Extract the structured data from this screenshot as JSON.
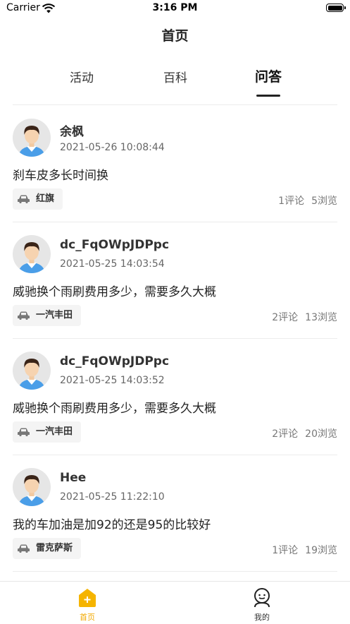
{
  "status_bar": {
    "carrier": "Carrier",
    "time": "3:16 PM"
  },
  "nav": {
    "title": "首页"
  },
  "tabs": [
    {
      "label": "活动"
    },
    {
      "label": "百科"
    },
    {
      "label": "问答",
      "active": true
    }
  ],
  "posts": [
    {
      "username": "余枫",
      "time": "2021-05-26 10:08:44",
      "question": "刹车皮多长时间换",
      "brand": "红旗",
      "comments": "1评论",
      "views": "5浏览"
    },
    {
      "username": "dc_FqOWpJDPpc",
      "time": "2021-05-25 14:03:54",
      "question": "威驰换个雨刷费用多少，需要多久大概",
      "brand": "一汽丰田",
      "comments": "2评论",
      "views": "13浏览"
    },
    {
      "username": "dc_FqOWpJDPpc",
      "time": "2021-05-25 14:03:52",
      "question": "威驰换个雨刷费用多少，需要多久大概",
      "brand": "一汽丰田",
      "comments": "2评论",
      "views": "20浏览"
    },
    {
      "username": "Hee",
      "time": "2021-05-25 11:22:10",
      "question": "我的车加油是加92的还是95的比较好",
      "brand": "雷克萨斯",
      "comments": "1评论",
      "views": "19浏览"
    }
  ],
  "tabbar": {
    "items": [
      {
        "label": "首页",
        "icon": "home-plus-icon",
        "active": true
      },
      {
        "label": "我的",
        "icon": "profile-face-icon"
      }
    ]
  },
  "colors": {
    "accent": "#f5b400",
    "text": "#222222",
    "muted": "#777777",
    "tag_bg": "#f4f4f4"
  }
}
